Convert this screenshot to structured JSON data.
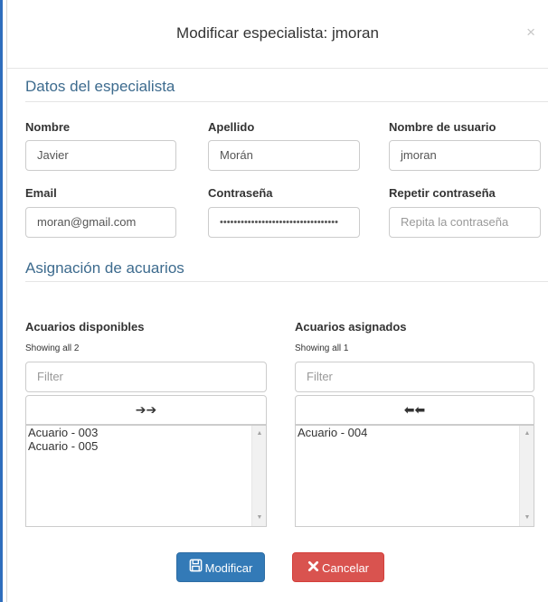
{
  "modal": {
    "title": "Modificar especialista: jmoran",
    "close": "×"
  },
  "specialist": {
    "section_title": "Datos del especialista",
    "nombre": {
      "label": "Nombre",
      "value": "Javier"
    },
    "apellido": {
      "label": "Apellido",
      "value": "Morán"
    },
    "usuario": {
      "label": "Nombre de usuario",
      "value": "jmoran"
    },
    "email": {
      "label": "Email",
      "value": "moran@gmail.com"
    },
    "password": {
      "label": "Contraseña",
      "value": "••••••••••••••••••••••••••••••••••"
    },
    "repeat_password": {
      "label": "Repetir contraseña",
      "placeholder": "Repita la contraseña"
    }
  },
  "assignment": {
    "section_title": "Asignación de acuarios",
    "available": {
      "title": "Acuarios disponibles",
      "showing": "Showing all 2",
      "filter_placeholder": "Filter",
      "move_label": "➔➔",
      "items": [
        "Acuario - 003",
        "Acuario - 005"
      ]
    },
    "assigned": {
      "title": "Acuarios asignados",
      "showing": "Showing all 1",
      "filter_placeholder": "Filter",
      "move_label": "⬅⬅",
      "items": [
        "Acuario - 004"
      ]
    }
  },
  "actions": {
    "modify": {
      "label": "Modificar",
      "icon": "save-icon",
      "color": "#337ab7"
    },
    "cancel": {
      "label": "Cancelar",
      "icon": "close-icon",
      "color": "#d9534f"
    }
  },
  "colors": {
    "section_title": "#3d6b8e",
    "page_edge": "#2f6ebd"
  }
}
